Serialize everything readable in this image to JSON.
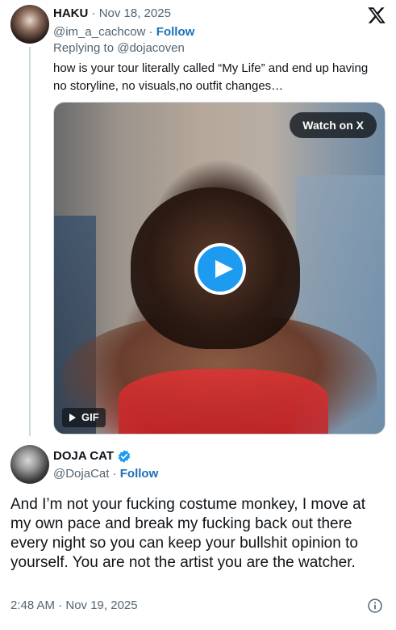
{
  "reply": {
    "author_name": "HAKU",
    "separator": "·",
    "date": "Nov 18, 2025",
    "handle": "@im_a_cachcow",
    "follow_label": "Follow",
    "replying_to": "Replying to @dojacoven",
    "text": "how is your tour literally called “My Life” and end up having no storyline, no visuals,no outfit changes…",
    "media": {
      "watch_label": "Watch on X",
      "badge_label": "GIF",
      "play_icon": "play-icon"
    }
  },
  "main_post": {
    "author_name": "DOJA CAT",
    "verified_icon": "verified-badge-icon",
    "handle": "@DojaCat",
    "separator": "·",
    "follow_label": "Follow",
    "text": "And I’m not your fucking costume monkey, I move at my own pace and break my fucking back out there every night so you can keep your bullshit opinion to yourself. You are not the artist you are the watcher.",
    "timestamp": "2:48 AM · Nov 19, 2025",
    "info_icon": "info-icon"
  },
  "brand": {
    "logo_icon": "x-logo-icon",
    "accent": "#1d9bf0",
    "follow_color": "#1d6fb8",
    "muted_color": "#536471"
  }
}
